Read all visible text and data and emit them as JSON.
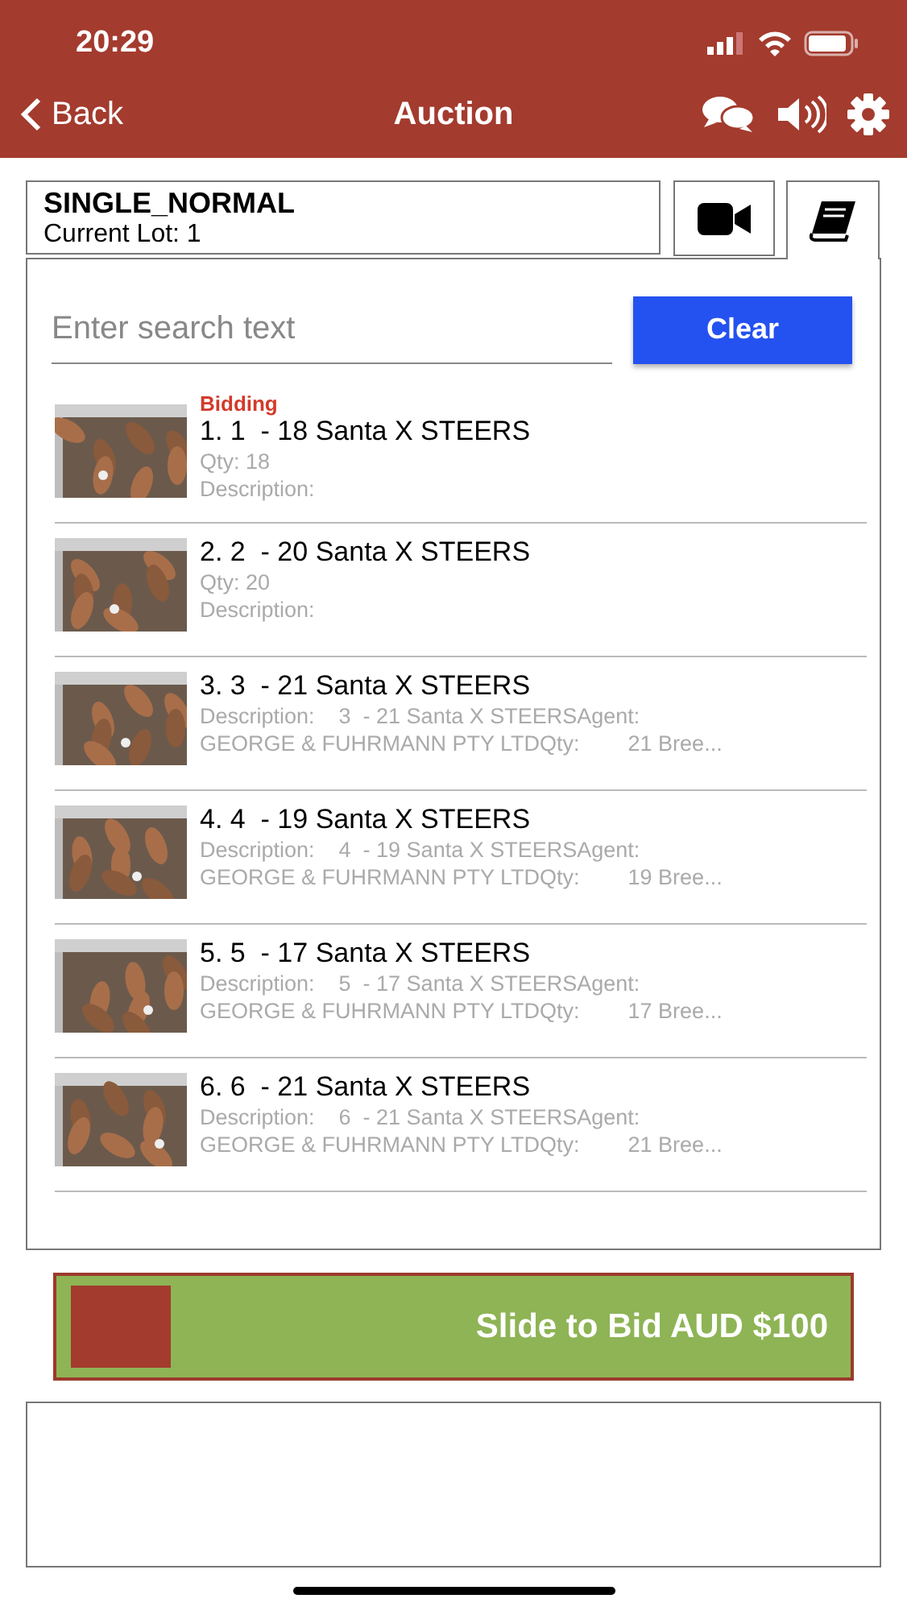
{
  "status_bar": {
    "time": "20:29"
  },
  "nav": {
    "back": "Back",
    "title": "Auction"
  },
  "header": {
    "sale_type": "SINGLE_NORMAL",
    "current_lot": "Current Lot: 1"
  },
  "tabs": [
    {
      "kind": "video",
      "selected": false
    },
    {
      "kind": "catalogue",
      "selected": true
    }
  ],
  "search": {
    "placeholder": "Enter search text",
    "clear": "Clear"
  },
  "lots": [
    {
      "status": "Bidding",
      "title": "1. 1  - 18 Santa X STEERS",
      "lines": [
        "Qty: 18",
        "Description:"
      ]
    },
    {
      "title": "2. 2  - 20 Santa X STEERS",
      "lines": [
        "Qty: 20",
        "Description:"
      ]
    },
    {
      "title": "3. 3  - 21 Santa X STEERS",
      "lines": [
        "Description:    3  - 21 Santa X STEERSAgent:",
        "GEORGE & FUHRMANN PTY LTDQty:        21 Bree..."
      ]
    },
    {
      "title": "4. 4  - 19 Santa X STEERS",
      "lines": [
        "Description:    4  - 19 Santa X STEERSAgent:",
        "GEORGE & FUHRMANN PTY LTDQty:        19 Bree..."
      ]
    },
    {
      "title": "5. 5  - 17 Santa X STEERS",
      "lines": [
        "Description:    5  - 17 Santa X STEERSAgent:",
        "GEORGE & FUHRMANN PTY LTDQty:        17 Bree..."
      ]
    },
    {
      "title": "6. 6  - 21 Santa X STEERS",
      "lines": [
        "Description:    6  - 21 Santa X STEERSAgent:",
        "GEORGE & FUHRMANN PTY LTDQty:        21 Bree..."
      ]
    }
  ],
  "bid_slider": {
    "label": "Slide to Bid AUD $100",
    "level": 0
  }
}
